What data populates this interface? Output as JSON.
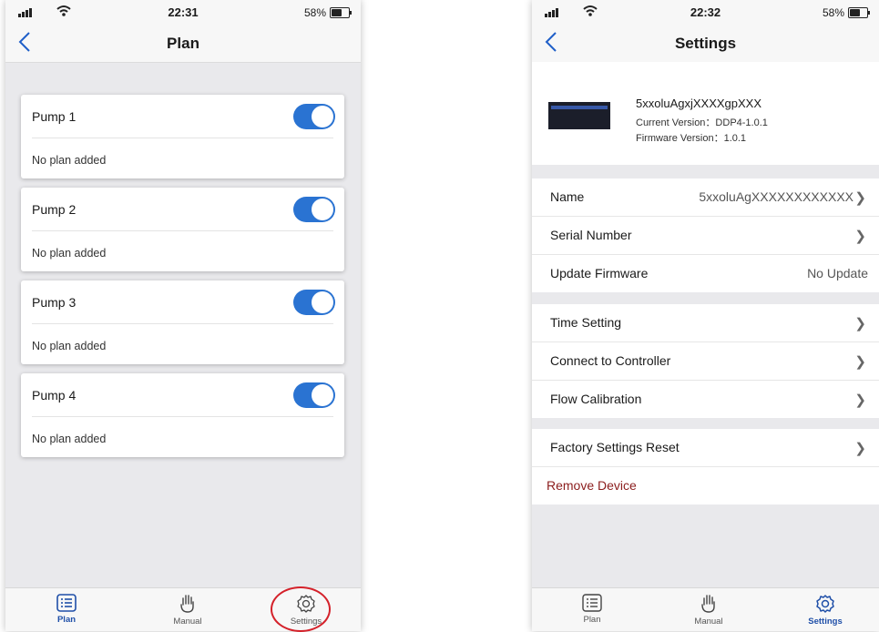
{
  "left": {
    "status": {
      "time": "22:31",
      "battery": "58%"
    },
    "nav": {
      "title": "Plan"
    },
    "pumps": [
      {
        "name": "Pump 1",
        "plan": "No plan added",
        "enabled": true
      },
      {
        "name": "Pump 2",
        "plan": "No plan added",
        "enabled": true
      },
      {
        "name": "Pump 3",
        "plan": "No plan added",
        "enabled": true
      },
      {
        "name": "Pump 4",
        "plan": "No plan added",
        "enabled": true
      }
    ],
    "tabs": [
      {
        "label": "Plan",
        "icon": "list-icon",
        "active": true
      },
      {
        "label": "Manual",
        "icon": "hand-icon",
        "active": false
      },
      {
        "label": "Settings",
        "icon": "gear-icon",
        "active": false
      }
    ]
  },
  "right": {
    "status": {
      "time": "22:32",
      "battery": "58%"
    },
    "nav": {
      "title": "Settings"
    },
    "device": {
      "name": "5xxoluAgxjXXXXgpXXX",
      "current_version": "Current Version：DDP4-1.0.1",
      "firmware_version": "Firmware Version：1.0.1"
    },
    "rows": {
      "name_label": "Name",
      "name_value": "5xxoluAgXXXXXXXXXXXX",
      "serial_label": "Serial Number",
      "update_label": "Update Firmware",
      "update_value": "No Update",
      "time_label": "Time Setting",
      "controller_label": "Connect to Controller",
      "flow_label": "Flow Calibration",
      "reset_label": "Factory Settings Reset",
      "remove_label": "Remove Device"
    },
    "tabs": [
      {
        "label": "Plan",
        "icon": "list-icon",
        "active": false
      },
      {
        "label": "Manual",
        "icon": "hand-icon",
        "active": false
      },
      {
        "label": "Settings",
        "icon": "gear-icon",
        "active": true
      }
    ]
  },
  "colors": {
    "toggle_on": "#2a73d2",
    "active_tab": "#1f4fa8",
    "remove": "#8b1d1d",
    "annotation": "#d4212a"
  }
}
